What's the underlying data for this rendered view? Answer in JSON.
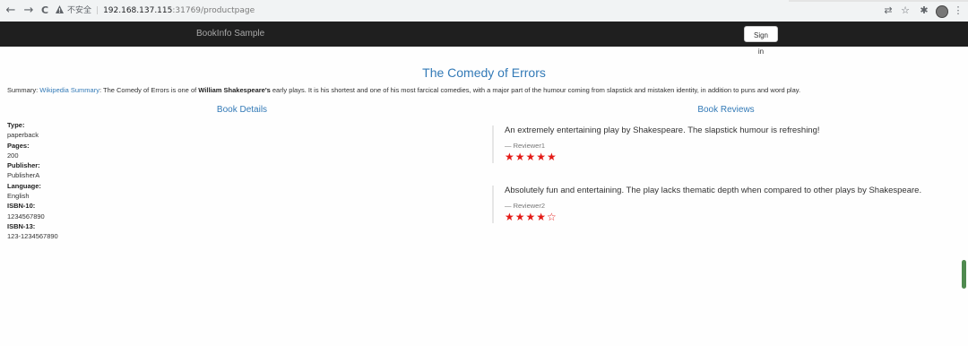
{
  "browser": {
    "back_icon": "←",
    "forward_icon": "→",
    "reload_icon": "C",
    "security_warning": "不安全",
    "url_host": "192.168.137.115",
    "url_path": ":31769/productpage",
    "translate_icon": "⇄",
    "star_icon": "☆",
    "extensions_icon": "✱",
    "menu_icon": "⋮"
  },
  "navbar": {
    "brand": "BookInfo Sample",
    "signin_label": "Sign in"
  },
  "product": {
    "title": "The Comedy of Errors",
    "summary_prefix": "Summary: ",
    "summary_link": "Wikipedia Summary",
    "summary_part1": ": The Comedy of Errors is one of ",
    "summary_bold": "William Shakespeare's",
    "summary_part2": " early plays. It is his shortest and one of his most farcical comedies, with a major part of the humour coming from slapstick and mistaken identity, in addition to puns and word play."
  },
  "details": {
    "heading": "Book Details",
    "type_label": "Type:",
    "type_value": "paperback",
    "pages_label": "Pages:",
    "pages_value": "200",
    "publisher_label": "Publisher:",
    "publisher_value": "PublisherA",
    "language_label": "Language:",
    "language_value": "English",
    "isbn10_label": "ISBN-10:",
    "isbn10_value": "1234567890",
    "isbn13_label": "ISBN-13:",
    "isbn13_value": "123-1234567890"
  },
  "reviews": {
    "heading": "Book Reviews",
    "items": [
      {
        "text": "An extremely entertaining play by Shakespeare. The slapstick humour is refreshing!",
        "reviewer": "— Reviewer1",
        "rating": 5,
        "stars": "★★★★★"
      },
      {
        "text": "Absolutely fun and entertaining. The play lacks thematic depth when compared to other plays by Shakespeare.",
        "reviewer": "— Reviewer2",
        "rating": 4,
        "stars": "★★★★☆"
      }
    ]
  },
  "colors": {
    "accent": "#337ab7",
    "navbar": "#1f1f1f",
    "star": "#e41b17"
  }
}
